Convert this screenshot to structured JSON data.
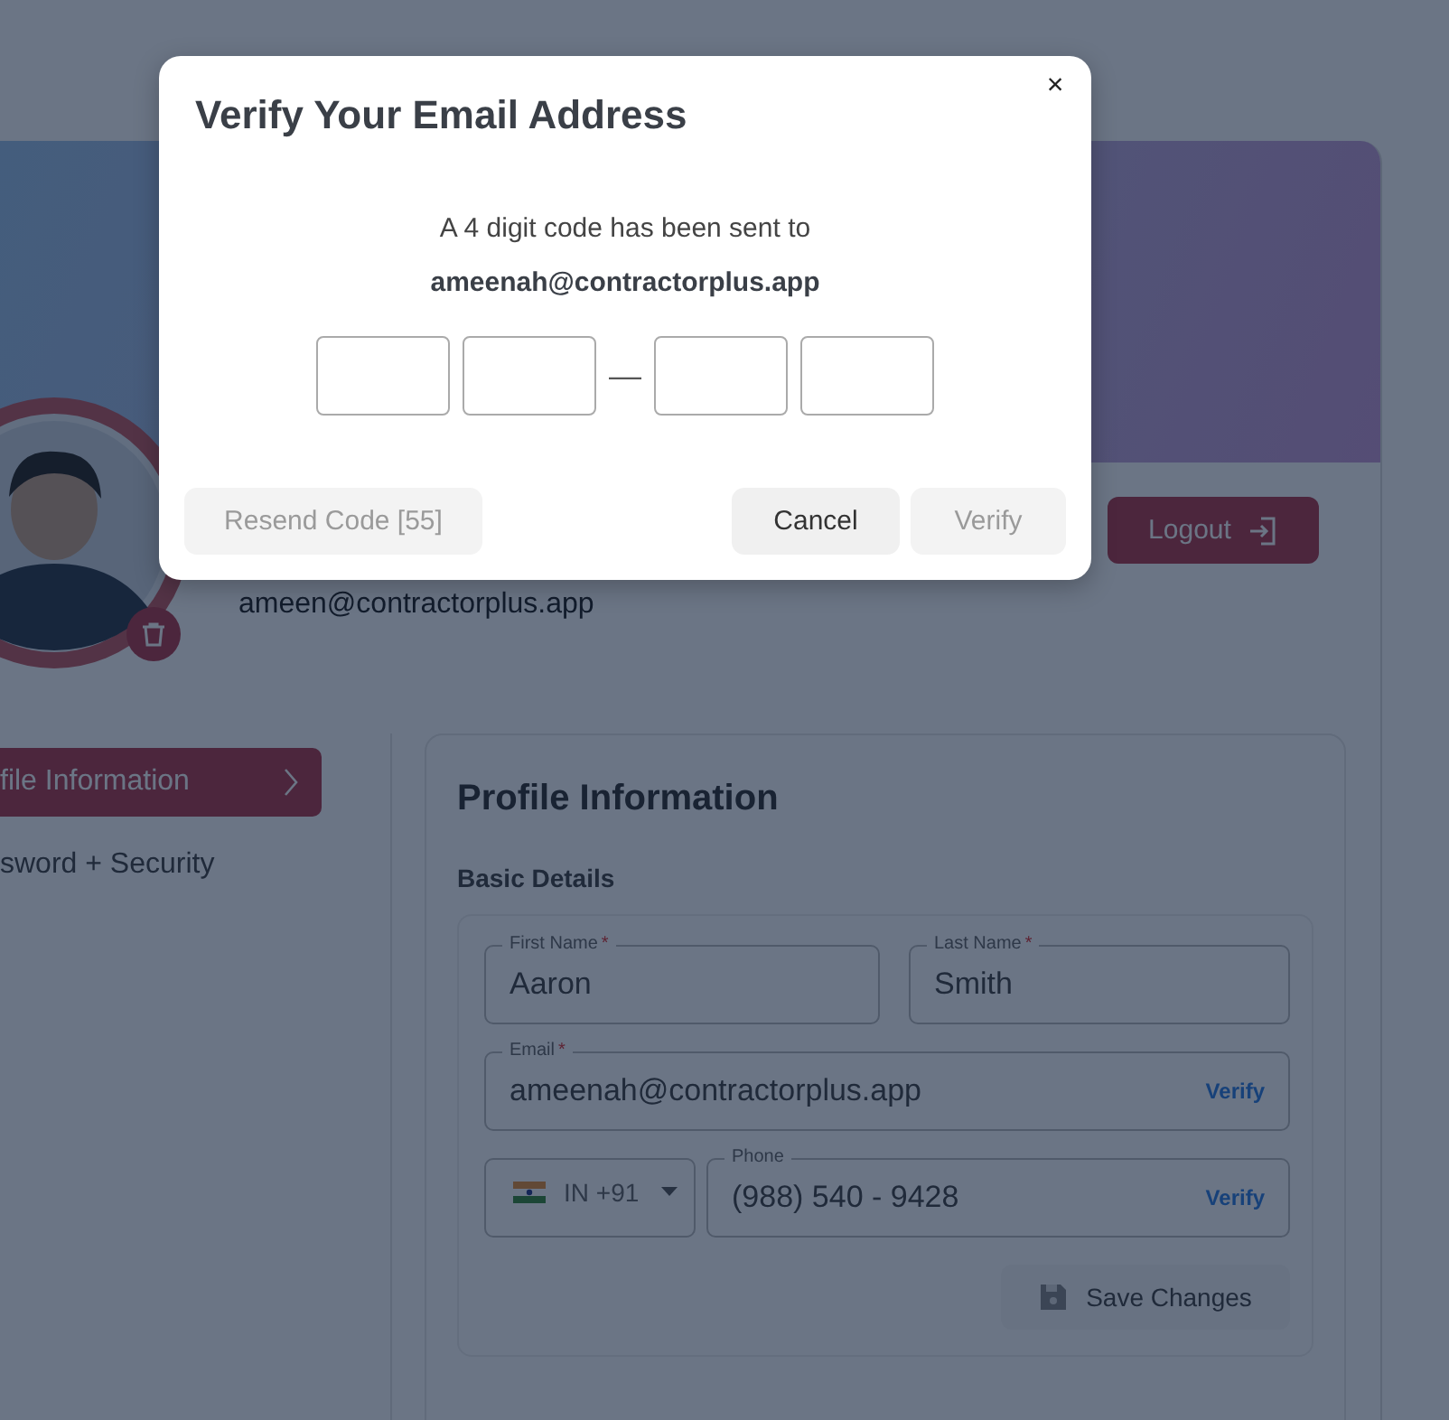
{
  "background_page": {
    "user_email": "ameen@contractorplus.app",
    "logout_button": "Logout",
    "nav": [
      {
        "label": "file Information",
        "selected": true
      },
      {
        "label": "sword + Security",
        "selected": false
      }
    ],
    "panel": {
      "title": "Profile Information",
      "section": "Basic Details",
      "fields": [
        {
          "kind": "text",
          "label": "First Name",
          "required_mark": "*",
          "value": "Aaron"
        },
        {
          "kind": "text",
          "label": "Last Name",
          "required_mark": "*",
          "value": "Smith"
        },
        {
          "kind": "email",
          "label": "Email",
          "required_mark": "*",
          "value": "ameenah@contractorplus.app",
          "action": "Verify"
        },
        {
          "kind": "country",
          "value": "IN +91"
        },
        {
          "kind": "phone",
          "label": "Phone",
          "value": "(988) 540 - 9428",
          "action": "Verify"
        }
      ],
      "save_button": {
        "label": "Save Changes",
        "disabled": true
      }
    }
  },
  "dialog": {
    "title": "Verify Your Email Address",
    "close": "×",
    "message": "A 4 digit code has been sent to",
    "email": "ameenah@contractorplus.app",
    "separator": "—",
    "buttons": [
      {
        "kind": "resend",
        "label": "Resend Code [55]",
        "disabled": true
      },
      {
        "kind": "cancel",
        "label": "Cancel",
        "disabled": false
      },
      {
        "kind": "verify",
        "label": "Verify",
        "disabled": true
      }
    ]
  }
}
